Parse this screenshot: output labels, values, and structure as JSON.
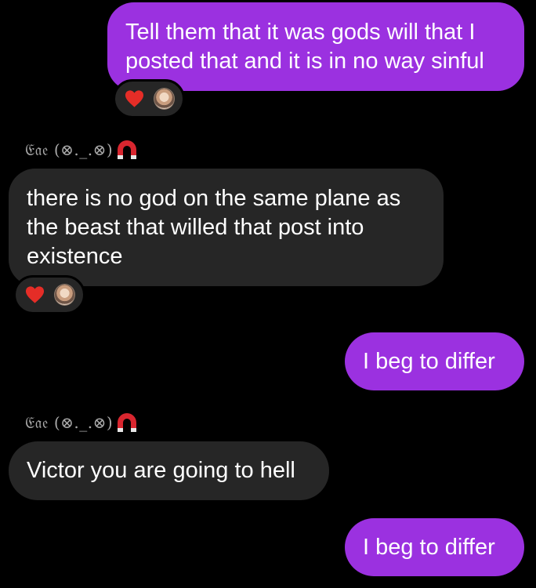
{
  "thread": {
    "messages": [
      {
        "id": "m1",
        "direction": "outgoing",
        "text": "Tell them that it was gods will that I\nposted that and it is in no way sinful",
        "reactions": [
          "heart",
          "avatar"
        ]
      },
      {
        "id": "m2",
        "direction": "incoming",
        "sender": "𝔈𝔞𝔢 (⊗._.⊗)",
        "sender_badge": "magnet-icon",
        "text": "there is no god on the same plane as\nthe beast that willed that post into\nexistence",
        "reactions": [
          "heart",
          "avatar"
        ]
      },
      {
        "id": "m3",
        "direction": "outgoing",
        "text": "I beg to differ"
      },
      {
        "id": "m4",
        "direction": "incoming",
        "sender": "𝔈𝔞𝔢 (⊗._.⊗)",
        "sender_badge": "magnet-icon",
        "text": "Victor you are going to hell"
      },
      {
        "id": "m5",
        "direction": "outgoing",
        "text": "I beg to differ"
      }
    ]
  },
  "colors": {
    "background": "#000000",
    "outgoing_bubble": "#9b31e0",
    "incoming_bubble": "#262626",
    "sender_name": "#a9a9a9",
    "heart": "#e52d27",
    "magnet": "#d8262f"
  },
  "icons": {
    "reaction_heart": "heart-icon",
    "reaction_avatar": "reactor-avatar",
    "sender_badge": "magnet-icon"
  }
}
